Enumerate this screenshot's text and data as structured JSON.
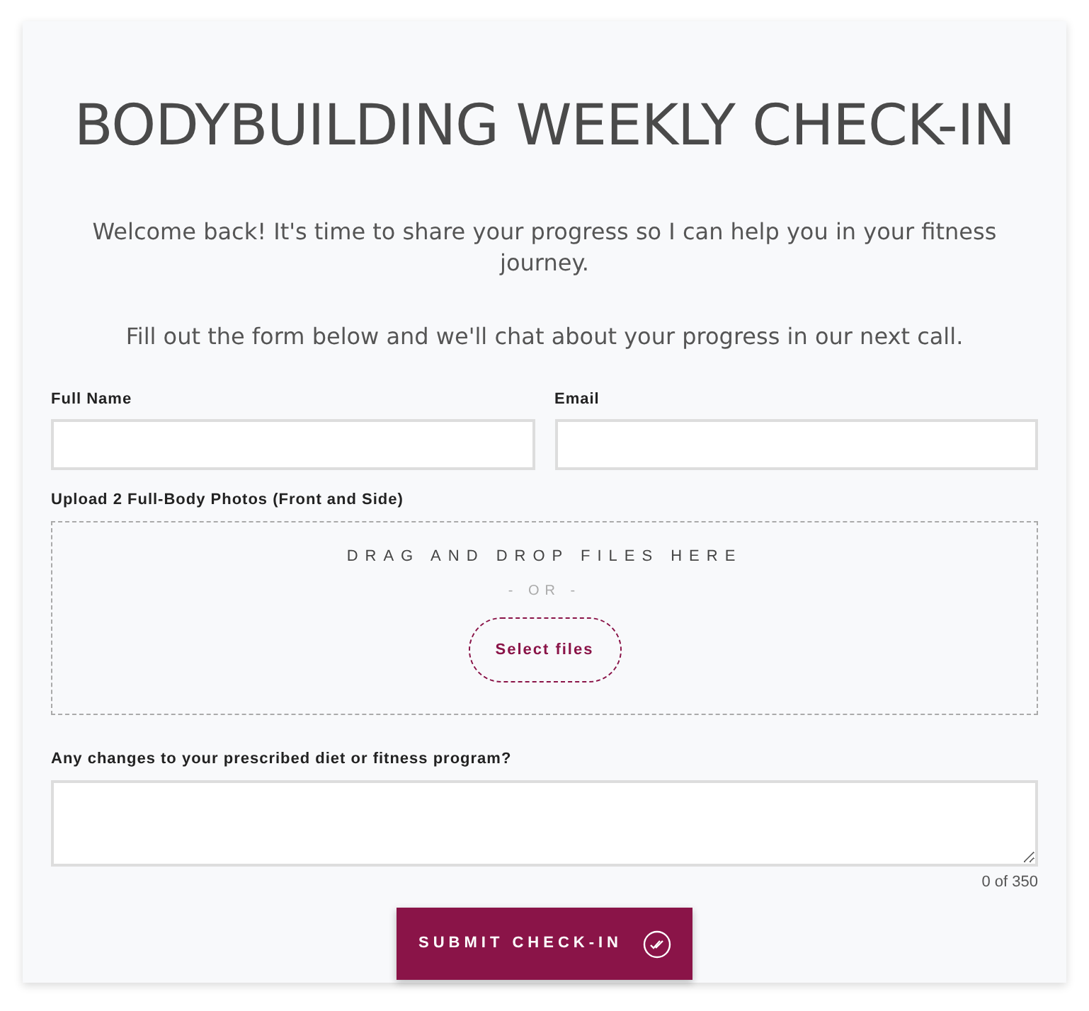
{
  "title": "BODYBUILDING WEEKLY CHECK-IN",
  "intro": [
    "Welcome back! It's time to share your progress so I can help you in your fitness journey.",
    "Fill out the form below and we'll chat about your progress in our next call."
  ],
  "fields": [
    {
      "label": "Full Name"
    },
    {
      "label": "Email"
    }
  ],
  "upload": {
    "label": "Upload 2 Full-Body Photos (Front and Side)",
    "drop_text": "DRAG AND DROP FILES HERE",
    "or_text": "- OR -",
    "button": "Select files"
  },
  "textarea": {
    "label": "Any changes to your prescribed diet or fitness program?",
    "counter": "0 of 350"
  },
  "submit": "SUBMIT CHECK-IN"
}
